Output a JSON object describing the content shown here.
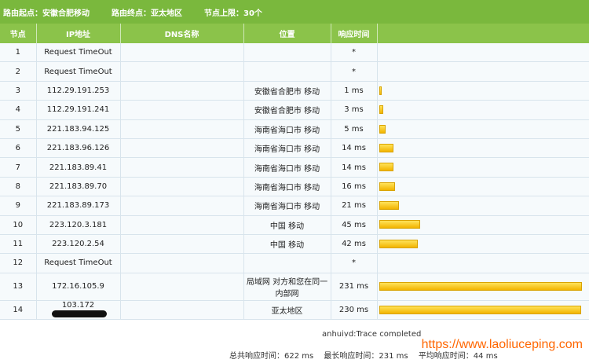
{
  "header": {
    "start_label": "路由起点：",
    "start_value": "安徽合肥移动",
    "end_label": "路由终点：",
    "end_value": "亚太地区",
    "limit_label": "节点上限：",
    "limit_value": "30个"
  },
  "columns": [
    "节点",
    "IP地址",
    "DNS名称",
    "位置",
    "响应时间",
    ""
  ],
  "rows": [
    {
      "node": "1",
      "ip": "Request TimeOut",
      "dns": "",
      "loc": "",
      "time": "*",
      "bar": 0
    },
    {
      "node": "2",
      "ip": "Request TimeOut",
      "dns": "",
      "loc": "",
      "time": "*",
      "bar": 0
    },
    {
      "node": "3",
      "ip": "112.29.191.253",
      "dns": "",
      "loc": "安徽省合肥市 移动",
      "time": "1 ms",
      "bar": 0.004
    },
    {
      "node": "4",
      "ip": "112.29.191.241",
      "dns": "",
      "loc": "安徽省合肥市 移动",
      "time": "3 ms",
      "bar": 0.013
    },
    {
      "node": "5",
      "ip": "221.183.94.125",
      "dns": "",
      "loc": "海南省海口市 移动",
      "time": "5 ms",
      "bar": 0.022
    },
    {
      "node": "6",
      "ip": "221.183.96.126",
      "dns": "",
      "loc": "海南省海口市 移动",
      "time": "14 ms",
      "bar": 0.061
    },
    {
      "node": "7",
      "ip": "221.183.89.41",
      "dns": "",
      "loc": "海南省海口市 移动",
      "time": "14 ms",
      "bar": 0.061
    },
    {
      "node": "8",
      "ip": "221.183.89.70",
      "dns": "",
      "loc": "海南省海口市 移动",
      "time": "16 ms",
      "bar": 0.069
    },
    {
      "node": "9",
      "ip": "221.183.89.173",
      "dns": "",
      "loc": "海南省海口市 移动",
      "time": "21 ms",
      "bar": 0.091
    },
    {
      "node": "10",
      "ip": "223.120.3.181",
      "dns": "",
      "loc": "中国 移动",
      "time": "45 ms",
      "bar": 0.195
    },
    {
      "node": "11",
      "ip": "223.120.2.54",
      "dns": "",
      "loc": "中国 移动",
      "time": "42 ms",
      "bar": 0.182
    },
    {
      "node": "12",
      "ip": "Request TimeOut",
      "dns": "",
      "loc": "",
      "time": "*",
      "bar": 0
    },
    {
      "node": "13",
      "ip": "172.16.105.9",
      "dns": "",
      "loc": "局域网 对方和您在同一内部网",
      "time": "231 ms",
      "bar": 1.0
    },
    {
      "node": "14",
      "ip": "103.172",
      "dns": "",
      "loc": "亚太地区",
      "time": "230 ms",
      "bar": 0.996
    }
  ],
  "status": "anhuiyd:Trace completed",
  "summary": {
    "total": "总共响应时间：622 ms",
    "max": "最长响应时间：231 ms",
    "avg": "平均响应时间：44 ms"
  },
  "watermark": "https://www.laoliuceping.com"
}
